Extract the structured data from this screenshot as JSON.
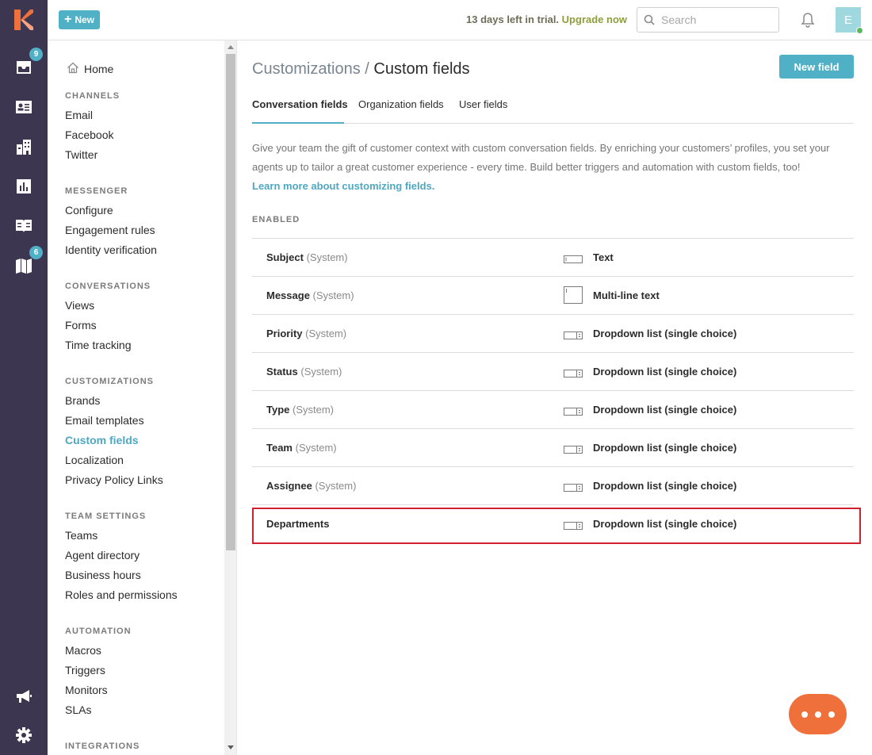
{
  "rail": {
    "items": [
      {
        "name": "inbox",
        "badge": "9"
      },
      {
        "name": "contacts",
        "badge": ""
      },
      {
        "name": "organizations",
        "badge": ""
      },
      {
        "name": "reports",
        "badge": ""
      },
      {
        "name": "knowledge-base",
        "badge": ""
      },
      {
        "name": "roadmap",
        "badge": "6"
      },
      {
        "name": "announcements",
        "badge": ""
      },
      {
        "name": "settings",
        "badge": ""
      }
    ]
  },
  "topbar": {
    "new_label": "New",
    "trial_text": "13 days left in trial.",
    "upgrade_label": "Upgrade now",
    "search_placeholder": "Search",
    "avatar_initial": "E"
  },
  "sidebar": {
    "home_label": "Home",
    "sections": [
      {
        "title": "CHANNELS",
        "items": [
          "Email",
          "Facebook",
          "Twitter"
        ]
      },
      {
        "title": "MESSENGER",
        "items": [
          "Configure",
          "Engagement rules",
          "Identity verification"
        ]
      },
      {
        "title": "CONVERSATIONS",
        "items": [
          "Views",
          "Forms",
          "Time tracking"
        ]
      },
      {
        "title": "CUSTOMIZATIONS",
        "items": [
          "Brands",
          "Email templates",
          "Custom fields",
          "Localization",
          "Privacy Policy Links"
        ]
      },
      {
        "title": "TEAM SETTINGS",
        "items": [
          "Teams",
          "Agent directory",
          "Business hours",
          "Roles and permissions"
        ]
      },
      {
        "title": "AUTOMATION",
        "items": [
          "Macros",
          "Triggers",
          "Monitors",
          "SLAs"
        ]
      },
      {
        "title": "INTEGRATIONS",
        "items": []
      }
    ],
    "active_item": "Custom fields"
  },
  "main": {
    "breadcrumb_parent": "Customizations",
    "breadcrumb_sep": " / ",
    "title": "Custom fields",
    "new_field_label": "New field",
    "tabs": [
      "Conversation fields",
      "Organization fields",
      "User fields"
    ],
    "active_tab": "Conversation fields",
    "description": "Give your team the gift of customer context with custom conversation fields. By enriching your customers’ profiles, you set your agents up to tailor a great customer experience - every time. Build better triggers and automation with custom fields, too!",
    "learn_more": "Learn more about customizing fields.",
    "enabled_label": "ENABLED",
    "fields": [
      {
        "name": "Subject",
        "system": "(System)",
        "type": "Text",
        "icon": "text-field-icon"
      },
      {
        "name": "Message",
        "system": "(System)",
        "type": "Multi-line text",
        "icon": "multiline-text-icon"
      },
      {
        "name": "Priority",
        "system": "(System)",
        "type": "Dropdown list (single choice)",
        "icon": "dropdown-icon"
      },
      {
        "name": "Status",
        "system": "(System)",
        "type": "Dropdown list (single choice)",
        "icon": "dropdown-icon"
      },
      {
        "name": "Type",
        "system": "(System)",
        "type": "Dropdown list (single choice)",
        "icon": "dropdown-icon"
      },
      {
        "name": "Team",
        "system": "(System)",
        "type": "Dropdown list (single choice)",
        "icon": "dropdown-icon"
      },
      {
        "name": "Assignee",
        "system": "(System)",
        "type": "Dropdown list (single choice)",
        "icon": "dropdown-icon"
      },
      {
        "name": "Departments",
        "system": "",
        "type": "Dropdown list (single choice)",
        "icon": "dropdown-icon"
      }
    ]
  },
  "colors": {
    "accent": "#4fb0c6",
    "rail_bg": "#3d3650",
    "highlight": "#d0202e",
    "chat_fab": "#f0703c"
  }
}
